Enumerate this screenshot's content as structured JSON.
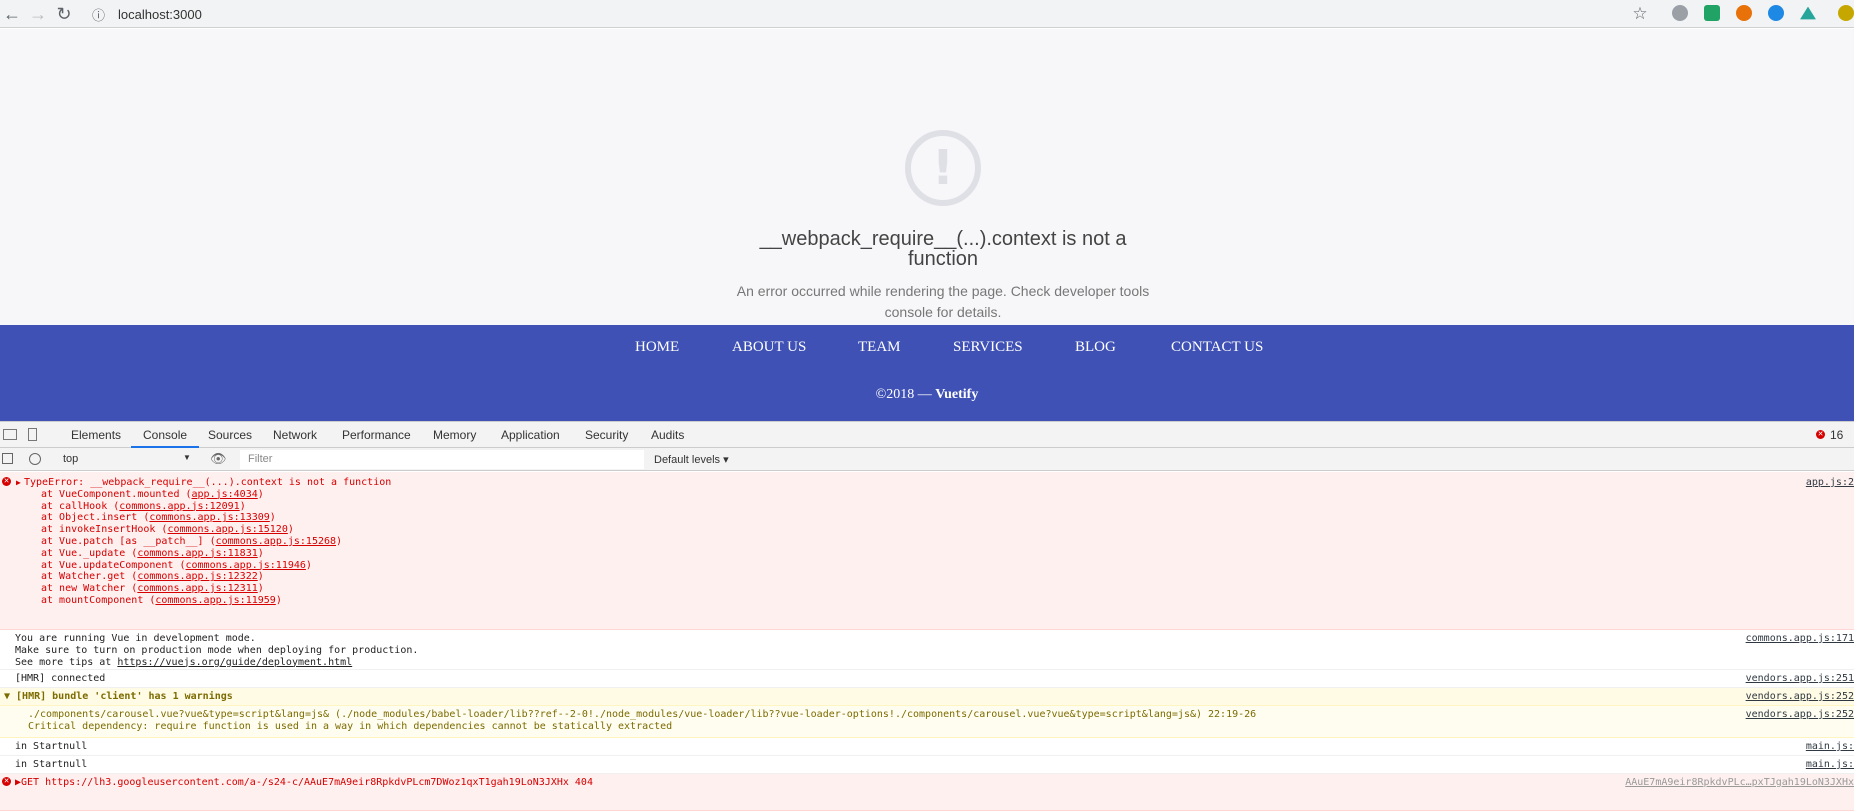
{
  "browser": {
    "url": "localhost:3000",
    "back": "←",
    "forward": "→",
    "reload": "↻",
    "info": "ⓘ",
    "star": "☆"
  },
  "page": {
    "error_icon": "!",
    "error_title": "__webpack_require__(...).context is not a function",
    "error_message": "An error occurred while rendering the page. Check developer tools console for details."
  },
  "footer": {
    "nav": [
      "HOME",
      "ABOUT US",
      "TEAM",
      "SERVICES",
      "BLOG",
      "CONTACT US"
    ],
    "copyright_prefix": "©2018 — ",
    "copyright_brand": "Vuetify"
  },
  "devtools": {
    "tabs": [
      "Elements",
      "Console",
      "Sources",
      "Network",
      "Performance",
      "Memory",
      "Application",
      "Security",
      "Audits"
    ],
    "active_tab": "Console",
    "error_count": "16",
    "context": "top",
    "filter_placeholder": "Filter",
    "levels": "Default levels ▾",
    "error": {
      "head": "TypeError: __webpack_require__(...).context is not a function",
      "source": "app.js:2",
      "stack": [
        {
          "fn": "at VueComponent.mounted (",
          "loc": "app.js:4034",
          "end": ")"
        },
        {
          "fn": "at callHook (",
          "loc": "commons.app.js:12091",
          "end": ")"
        },
        {
          "fn": "at Object.insert (",
          "loc": "commons.app.js:13309",
          "end": ")"
        },
        {
          "fn": "at invokeInsertHook (",
          "loc": "commons.app.js:15120",
          "end": ")"
        },
        {
          "fn": "at Vue.patch [as __patch__] (",
          "loc": "commons.app.js:15268",
          "end": ")"
        },
        {
          "fn": "at Vue._update (",
          "loc": "commons.app.js:11831",
          "end": ")"
        },
        {
          "fn": "at Vue.updateComponent (",
          "loc": "commons.app.js:11946",
          "end": ")"
        },
        {
          "fn": "at Watcher.get (",
          "loc": "commons.app.js:12322",
          "end": ")"
        },
        {
          "fn": "at new Watcher (",
          "loc": "commons.app.js:12311",
          "end": ")"
        },
        {
          "fn": "at mountComponent (",
          "loc": "commons.app.js:11959",
          "end": ")"
        }
      ]
    },
    "vue": {
      "l1": "You are running Vue in development mode.",
      "l2": "Make sure to turn on production mode when deploying for production.",
      "l3a": "See more tips at ",
      "l3b": "https://vuejs.org/guide/deployment.html",
      "source": "commons.app.js:171"
    },
    "hmr": {
      "text": "[HMR] connected",
      "source": "vendors.app.js:251"
    },
    "bundle": {
      "text": "▼ [HMR] bundle 'client' has 1 warnings",
      "source": "vendors.app.js:252"
    },
    "warn": {
      "l1": "./components/carousel.vue?vue&type=script&lang=js& (./node_modules/babel-loader/lib??ref--2-0!./node_modules/vue-loader/lib??vue-loader-options!./components/carousel.vue?vue&type=script&lang=js&) 22:19-26",
      "l2": "Critical dependency: require function is used in a way in which dependencies cannot be statically extracted",
      "source": "vendors.app.js:252"
    },
    "start1": {
      "text": "in Startnull",
      "source": "main.js:"
    },
    "start2": {
      "text": "in Startnull",
      "source": "main.js:"
    },
    "get": {
      "text": "▶GET https://lh3.googleusercontent.com/a-/s24-c/AAuE7mA9eir8RpkdvPLcm7DWoz1qxT1gah19LoN3JXHx 404",
      "source": "AAuE7mA9eir8RpkdvPLc…pxTJgah19LoN3JXHx"
    }
  },
  "colors": {
    "footer": "#3f51b5",
    "error_bg": "#fff0f0",
    "error_text": "#d60000",
    "warning_bg": "#fffbe5"
  }
}
